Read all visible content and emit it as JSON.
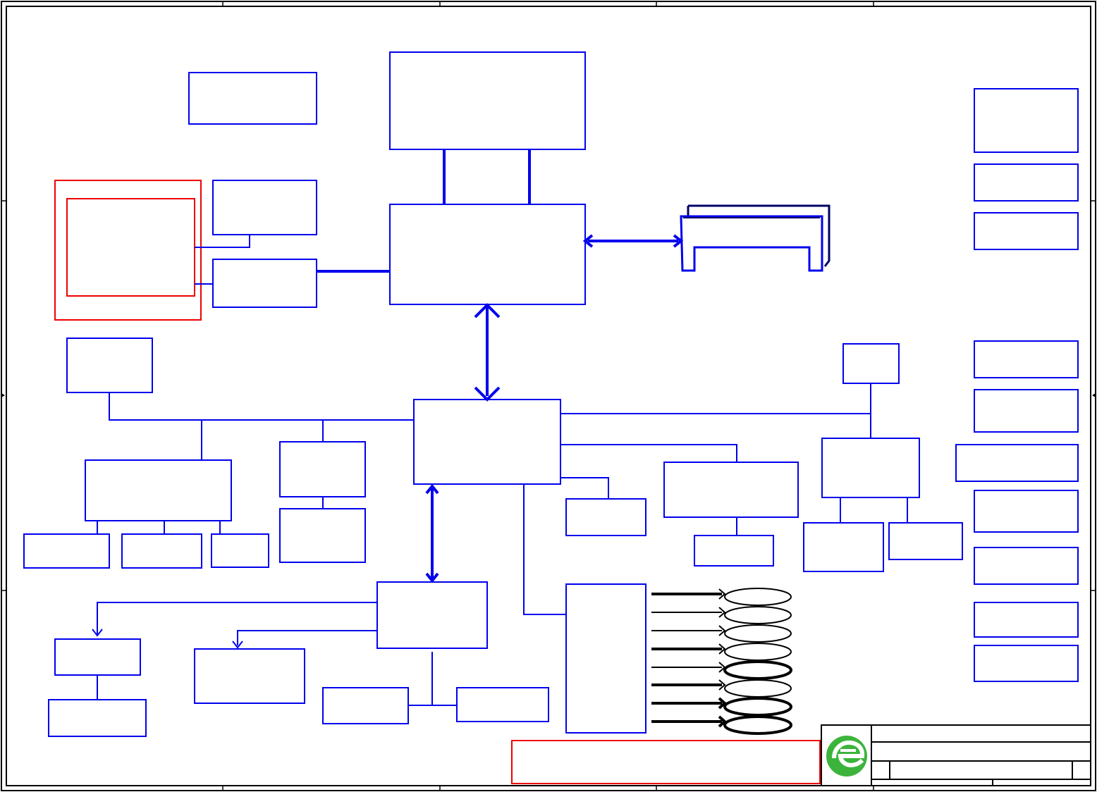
{
  "colors": {
    "block_stroke": "#0000ee",
    "highlight_stroke": "#ee0000",
    "frame_stroke": "#000000",
    "logo_green": "#3cb43c"
  },
  "title_block": {
    "logo": "green-e-logo-icon"
  },
  "connectors": {
    "count": 8
  }
}
